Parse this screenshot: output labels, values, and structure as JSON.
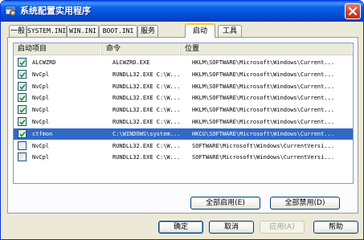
{
  "window": {
    "title": "系统配置实用程序"
  },
  "tabs": [
    {
      "label": "一般",
      "active": false
    },
    {
      "label": "SYSTEM.INI",
      "active": false
    },
    {
      "label": "WIN.INI",
      "active": false
    },
    {
      "label": "BOOT.INI",
      "active": false
    },
    {
      "label": "服务",
      "active": false
    },
    {
      "label": "启动",
      "active": true
    },
    {
      "label": "工具",
      "active": false
    }
  ],
  "list": {
    "columns": [
      "启动项目",
      "命令",
      "位置"
    ],
    "rows": [
      {
        "checked": true,
        "item": "ALCWZRD",
        "command": "ALCWZRD.EXE",
        "location": "HKLM\\SOFTWARE\\Microsoft\\Windows\\Current..."
      },
      {
        "checked": true,
        "item": "NvCpl",
        "command": "RUNDLL32.EXE C:\\W...",
        "location": "HKLM\\SOFTWARE\\Microsoft\\Windows\\Current..."
      },
      {
        "checked": true,
        "item": "NvCpl",
        "command": "RUNDLL32.EXE C:\\W...",
        "location": "HKLM\\SOFTWARE\\Microsoft\\Windows\\Current..."
      },
      {
        "checked": true,
        "item": "NvCpl",
        "command": "RUNDLL32.EXE C:\\W...",
        "location": "HKLM\\SOFTWARE\\Microsoft\\Windows\\Current..."
      },
      {
        "checked": true,
        "item": "NvCpl",
        "command": "RUNDLL32.EXE C:\\W...",
        "location": "HKLM\\SOFTWARE\\Microsoft\\Windows\\Current..."
      },
      {
        "checked": true,
        "item": "NvCpl",
        "command": "RUNDLL32.EXE C:\\W...",
        "location": "HKLM\\SOFTWARE\\Microsoft\\Windows\\Current..."
      },
      {
        "checked": true,
        "item": "ctfmon",
        "command": "C:\\WINDOWS\\system...",
        "location": "HKCU\\SOFTWARE\\Microsoft\\Windows\\Current...",
        "selected": true
      },
      {
        "checked": false,
        "item": "NvCpl",
        "command": "RUNDLL32.EXE C:\\W...",
        "location": "SOFTWARE\\Microsoft\\Windows\\CurrentVersi..."
      },
      {
        "checked": false,
        "item": "NvCpl",
        "command": "RUNDLL32.EXE C:\\W...",
        "location": "SOFTWARE\\Microsoft\\Windows\\CurrentVersi..."
      }
    ]
  },
  "buttons": {
    "enable_all": "全部启用(E)",
    "disable_all": "全部禁用(D)",
    "ok": "确定",
    "cancel": "取消",
    "apply": "应用(A)",
    "help": "帮助"
  },
  "colors": {
    "titlebar": "#0454d8",
    "selection": "#316ac5",
    "active_tab_accent": "#ffc83c",
    "face": "#ece9d8"
  },
  "icons": {
    "title": "system-config-icon",
    "close": "close-icon",
    "check": "checkmark-icon"
  }
}
